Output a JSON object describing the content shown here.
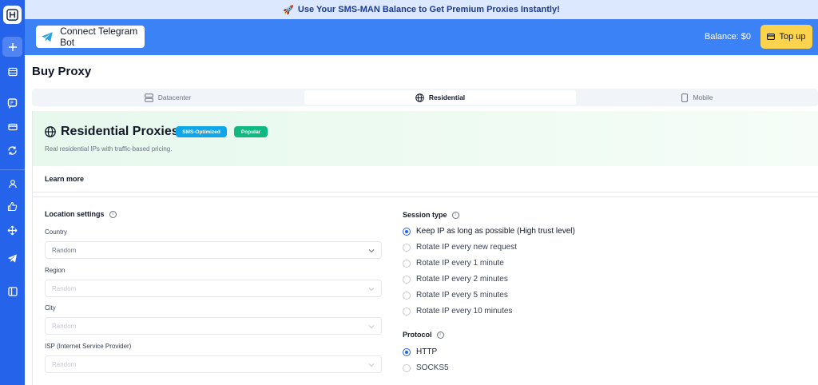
{
  "promo": {
    "icon": "rocket-icon",
    "text": "Use Your SMS-MAN Balance to Get Premium Proxies Instantly!"
  },
  "header": {
    "telegram_button": "Connect Telegram Bot",
    "balance_label": "Balance:",
    "balance_value": "$0",
    "topup_label": "Top up"
  },
  "page": {
    "title": "Buy Proxy"
  },
  "tabs": [
    {
      "label": "Datacenter",
      "icon": "server-icon",
      "active": false
    },
    {
      "label": "Residential",
      "icon": "globe-icon",
      "active": true
    },
    {
      "label": "Mobile",
      "icon": "phone-icon",
      "active": false
    }
  ],
  "hero": {
    "title": "Residential Proxies",
    "badges": [
      "SMS-Optimized",
      "Popular"
    ],
    "subtitle": "Real residential IPs with traffic-based pricing."
  },
  "learn_more": "Learn more",
  "location": {
    "title": "Location settings",
    "country": {
      "label": "Country",
      "value": "Random"
    },
    "region": {
      "label": "Region",
      "value": "Random"
    },
    "city": {
      "label": "City",
      "value": "Random"
    },
    "isp": {
      "label": "ISP (Internet Service Provider)",
      "value": "Random"
    }
  },
  "session": {
    "title": "Session type",
    "options": [
      "Keep IP as long as possible (High trust level)",
      "Rotate IP every new request",
      "Rotate IP every 1 minute",
      "Rotate IP every 2 minutes",
      "Rotate IP every 5 minutes",
      "Rotate IP every 10 minutes"
    ],
    "selected": 0
  },
  "protocol": {
    "title": "Protocol",
    "options": [
      "HTTP",
      "SOCKS5"
    ],
    "selected": 0
  },
  "colors": {
    "primary": "#2563eb",
    "header": "#3b82f6",
    "topup": "#fcd34d",
    "badge_sms": "#0ea5e9",
    "badge_popular": "#10b981"
  }
}
